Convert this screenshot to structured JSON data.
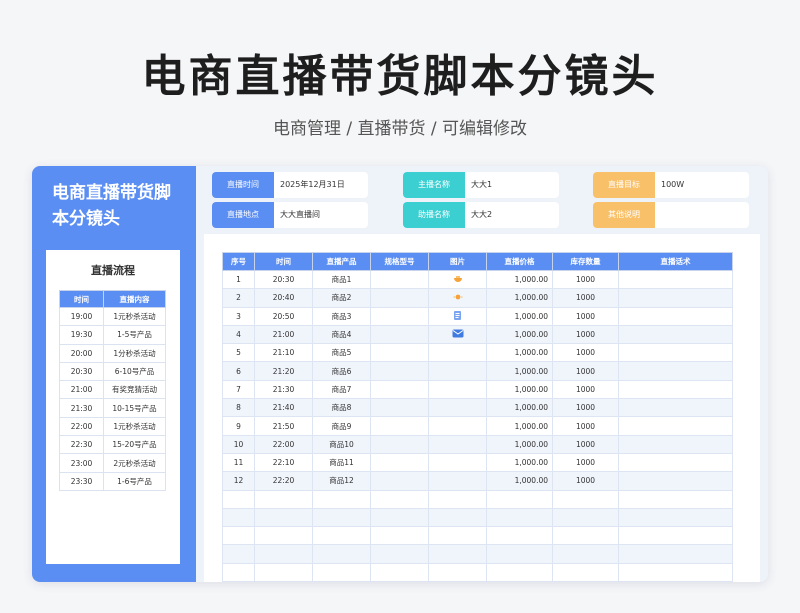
{
  "header": {
    "title": "电商直播带货脚本分镜头",
    "subtitle": "电商管理 / 直播带货 /  可编辑修改"
  },
  "colors": {
    "primary_blue": "#5b8ef2",
    "teal": "#3ccfd2",
    "orange": "#f9c06a"
  },
  "sidebar": {
    "title": "电商直播带货脚本分镜头",
    "flow": {
      "title": "直播流程",
      "columns": [
        "时间",
        "直播内容"
      ],
      "rows": [
        [
          "19:00",
          "1元秒杀活动"
        ],
        [
          "19:30",
          "1-5号产品"
        ],
        [
          "20:00",
          "1分秒杀活动"
        ],
        [
          "20:30",
          "6-10号产品"
        ],
        [
          "21:00",
          "有奖竞猜活动"
        ],
        [
          "21:30",
          "10-15号产品"
        ],
        [
          "22:00",
          "1元秒杀活动"
        ],
        [
          "22:30",
          "15-20号产品"
        ],
        [
          "23:00",
          "2元秒杀活动"
        ],
        [
          "23:30",
          "1-6号产品"
        ]
      ]
    }
  },
  "info": {
    "time_label": "直播时间",
    "time_value": "2025年12月31日",
    "place_label": "直播地点",
    "place_value": "大大直播间",
    "host_label": "主播名称",
    "host_value": "大大1",
    "assistant_label": "助播名称",
    "assistant_value": "大大2",
    "target_label": "直播目标",
    "target_value": "100W",
    "other_label": "其他说明",
    "other_value": ""
  },
  "table": {
    "columns": [
      "序号",
      "时间",
      "直播产品",
      "规格型号",
      "图片",
      "直播价格",
      "库存数量",
      "直播话术"
    ],
    "rows": [
      {
        "no": "1",
        "time": "20:30",
        "product": "商品1",
        "spec": "",
        "icon": "bowl-icon",
        "price": "1,000.00",
        "stock": "1000",
        "script": ""
      },
      {
        "no": "2",
        "time": "20:40",
        "product": "商品2",
        "spec": "",
        "icon": "sun-icon",
        "price": "1,000.00",
        "stock": "1000",
        "script": ""
      },
      {
        "no": "3",
        "time": "20:50",
        "product": "商品3",
        "spec": "",
        "icon": "document-icon",
        "price": "1,000.00",
        "stock": "1000",
        "script": ""
      },
      {
        "no": "4",
        "time": "21:00",
        "product": "商品4",
        "spec": "",
        "icon": "mail-icon",
        "price": "1,000.00",
        "stock": "1000",
        "script": ""
      },
      {
        "no": "5",
        "time": "21:10",
        "product": "商品5",
        "spec": "",
        "icon": "",
        "price": "1,000.00",
        "stock": "1000",
        "script": ""
      },
      {
        "no": "6",
        "time": "21:20",
        "product": "商品6",
        "spec": "",
        "icon": "",
        "price": "1,000.00",
        "stock": "1000",
        "script": ""
      },
      {
        "no": "7",
        "time": "21:30",
        "product": "商品7",
        "spec": "",
        "icon": "",
        "price": "1,000.00",
        "stock": "1000",
        "script": ""
      },
      {
        "no": "8",
        "time": "21:40",
        "product": "商品8",
        "spec": "",
        "icon": "",
        "price": "1,000.00",
        "stock": "1000",
        "script": ""
      },
      {
        "no": "9",
        "time": "21:50",
        "product": "商品9",
        "spec": "",
        "icon": "",
        "price": "1,000.00",
        "stock": "1000",
        "script": ""
      },
      {
        "no": "10",
        "time": "22:00",
        "product": "商品10",
        "spec": "",
        "icon": "",
        "price": "1,000.00",
        "stock": "1000",
        "script": ""
      },
      {
        "no": "11",
        "time": "22:10",
        "product": "商品11",
        "spec": "",
        "icon": "",
        "price": "1,000.00",
        "stock": "1000",
        "script": ""
      },
      {
        "no": "12",
        "time": "22:20",
        "product": "商品12",
        "spec": "",
        "icon": "",
        "price": "1,000.00",
        "stock": "1000",
        "script": ""
      }
    ],
    "empty_rows": 5
  }
}
